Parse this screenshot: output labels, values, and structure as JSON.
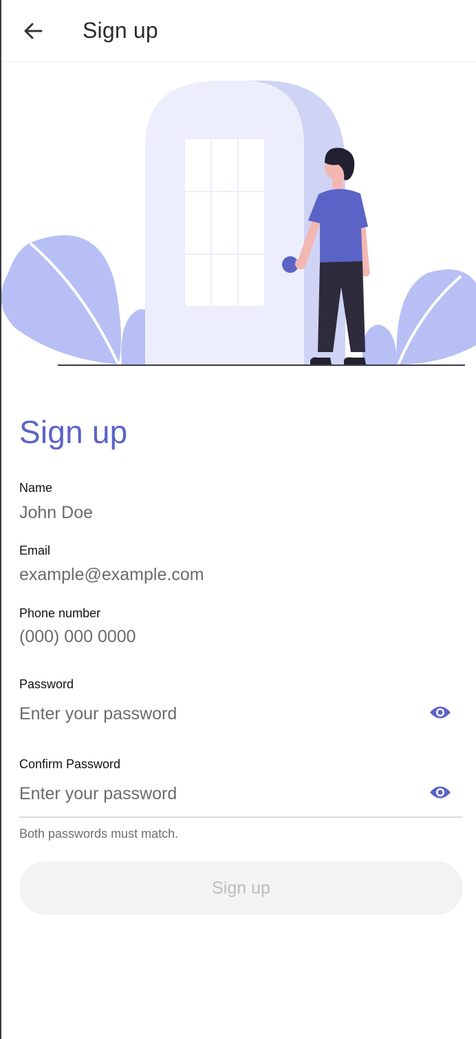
{
  "appbar": {
    "back_icon": "arrow-left-icon",
    "title": "Sign up"
  },
  "illustration": {
    "name": "person-at-door-illustration",
    "colors": {
      "door_front": "#eceefd",
      "door_shadow": "#cfd4f5",
      "leaf": "#b7bff5",
      "shirt": "#5b63c7",
      "pants": "#2e2b3d",
      "skin": "#f3b7b2",
      "hair": "#23212f"
    }
  },
  "form": {
    "heading": "Sign up",
    "name": {
      "label": "Name",
      "value": "John Doe"
    },
    "email": {
      "label": "Email",
      "value": "example@example.com"
    },
    "phone": {
      "label": "Phone number",
      "value": "(000) 000 0000"
    },
    "password": {
      "label": "Password",
      "placeholder": "Enter your password",
      "icon": "eye-icon"
    },
    "confirm_password": {
      "label": "Confirm Password",
      "placeholder": "Enter your password",
      "icon": "eye-icon"
    },
    "helper_text": "Both passwords must match.",
    "submit_label": "Sign up",
    "submit_enabled": false
  },
  "colors": {
    "accent": "#5b63c7",
    "button_disabled_bg": "#f3f3f3",
    "button_disabled_text": "#bdbdbd"
  }
}
